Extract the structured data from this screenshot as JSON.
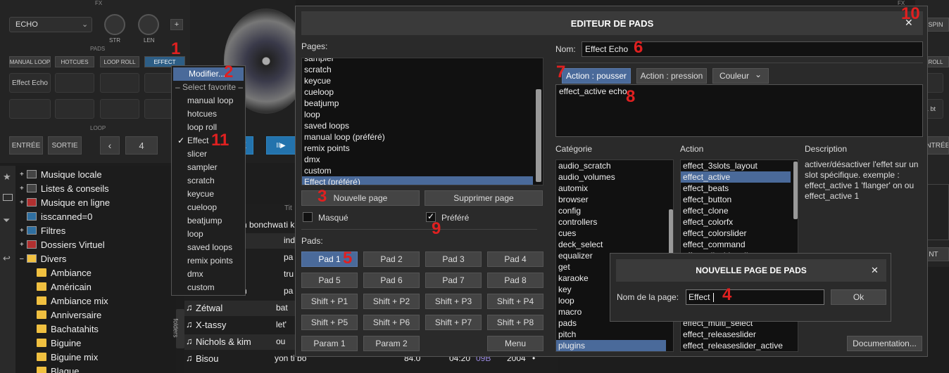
{
  "app": {
    "fx_label": "FX",
    "fx_label_right": "FX",
    "pads_label": "PADS",
    "loop_label": "LOOP",
    "echo_select": "ECHO",
    "knob_str": "STR",
    "knob_len": "LEN",
    "plus": "+",
    "pad_tabs": [
      "MANUAL LOOP",
      "HOTCUES",
      "LOOP ROLL",
      "EFFECT"
    ],
    "pad_first": "Effect Echo",
    "entree": "ENTRÉE",
    "sortie": "SORTIE",
    "loop_prev": "‹",
    "loop_value": "4",
    "right_spin": "SPIN",
    "right_roll": "ROLL",
    "right_entree": "ENTRÉE",
    "right_bt": "1 bt",
    "right_nt": "NT",
    "deck_button_e": "E",
    "deck_button_play": "II▶",
    "col_title": "Tit",
    "folders_tab": "folders"
  },
  "browser": {
    "items": [
      {
        "label": "Musique locale"
      },
      {
        "label": "Listes & conseils"
      },
      {
        "label": "Musique en ligne"
      },
      {
        "label": "isscanned=0"
      },
      {
        "label": "Filtres"
      },
      {
        "label": "Dossiers Virtuel"
      },
      {
        "label": "Divers"
      }
    ],
    "folders": [
      "Ambiance",
      "Américain",
      "Ambiance mix",
      "Anniversaire",
      "Bachatahits",
      "Biguine",
      "Biguine mix",
      "Blague"
    ]
  },
  "tracklist": {
    "rows": [
      {
        "artist": "n bonchwa",
        "title": "ti k"
      },
      {
        "artist": "",
        "title": "ind"
      },
      {
        "artist": "",
        "title": "pa"
      },
      {
        "artist": "",
        "title": "tru"
      },
      {
        "artist": "n",
        "title": "pa"
      },
      {
        "artist": "Zétwal",
        "title": "bat"
      },
      {
        "artist": "X-tassy",
        "title": "let'"
      },
      {
        "artist": "Nichols & kim",
        "title": "ou"
      },
      {
        "artist": "Bisou",
        "title": "yon ti bo",
        "bpm": "84.0",
        "len": "04:20",
        "key": "09B",
        "year": "2004",
        "mark": "•"
      }
    ]
  },
  "context_menu": {
    "modify": "Modifier...",
    "select_favorite": "– Select favorite –",
    "items": [
      "manual loop",
      "hotcues",
      "loop roll",
      "Effect",
      "slicer",
      "sampler",
      "scratch",
      "keycue",
      "cueloop",
      "beatjump",
      "loop",
      "saved loops",
      "remix points",
      "dmx",
      "custom"
    ],
    "checked": "Effect",
    "check_mark": "✓"
  },
  "editor": {
    "title": "EDITEUR DE PADS",
    "close": "✕",
    "pages_label": "Pages:",
    "pages": [
      "sampler",
      "scratch",
      "keycue",
      "cueloop",
      "beatjump",
      "loop",
      "saved loops",
      "manual loop (préféré)",
      "remix points",
      "dmx",
      "custom",
      "Effect (préféré)"
    ],
    "new_page": "Nouvelle page",
    "delete_page": "Supprimer page",
    "masque": "Masqué",
    "prefere": "Préféré",
    "check_mark": "✓",
    "pads_label": "Pads:",
    "pads": [
      "Pad 1",
      "Pad 2",
      "Pad 3",
      "Pad 4",
      "Pad 5",
      "Pad 6",
      "Pad 7",
      "Pad 8",
      "Shift + P1",
      "Shift + P2",
      "Shift + P3",
      "Shift + P4",
      "Shift + P5",
      "Shift + P6",
      "Shift + P7",
      "Shift + P8",
      "Param 1",
      "Param 2",
      "",
      "Menu"
    ],
    "nom_label": "Nom:",
    "nom_value": "Effect Echo",
    "tab_push": "Action : pousser",
    "tab_press": "Action : pression",
    "tab_color": "Couleur",
    "chevron": "⌄",
    "action_script": "effect_active echo",
    "categorie_label": "Catégorie",
    "action_label": "Action",
    "description_label": "Description",
    "categories": [
      "audio_scratch",
      "audio_volumes",
      "automix",
      "browser",
      "config",
      "controllers",
      "cues",
      "deck_select",
      "equalizer",
      "get",
      "karaoke",
      "key",
      "loop",
      "macro",
      "pads",
      "pitch",
      "plugins"
    ],
    "actions_top": [
      "effect_3slots_layout",
      "effect_active",
      "effect_beats",
      "effect_button",
      "effect_clone",
      "effect_colorfx",
      "effect_colorslider",
      "effect_command",
      "effect_disable_all"
    ],
    "actions_bottom": [
      "effect_multi_select",
      "effect_releaseslider",
      "effect_releaseslider_active"
    ],
    "description": "activer/désactiver l'effet sur un slot spécifique. exemple : effect_active 1 'flanger' on ou effect_active 1",
    "documentation": "Documentation..."
  },
  "new_page_dialog": {
    "title": "NOUVELLE PAGE DE PADS",
    "close": "✕",
    "label": "Nom de la page:",
    "value": "Effect",
    "ok": "Ok"
  },
  "annotations": [
    "1",
    "2",
    "3",
    "4",
    "5",
    "6",
    "7",
    "8",
    "9",
    "10",
    "11"
  ]
}
